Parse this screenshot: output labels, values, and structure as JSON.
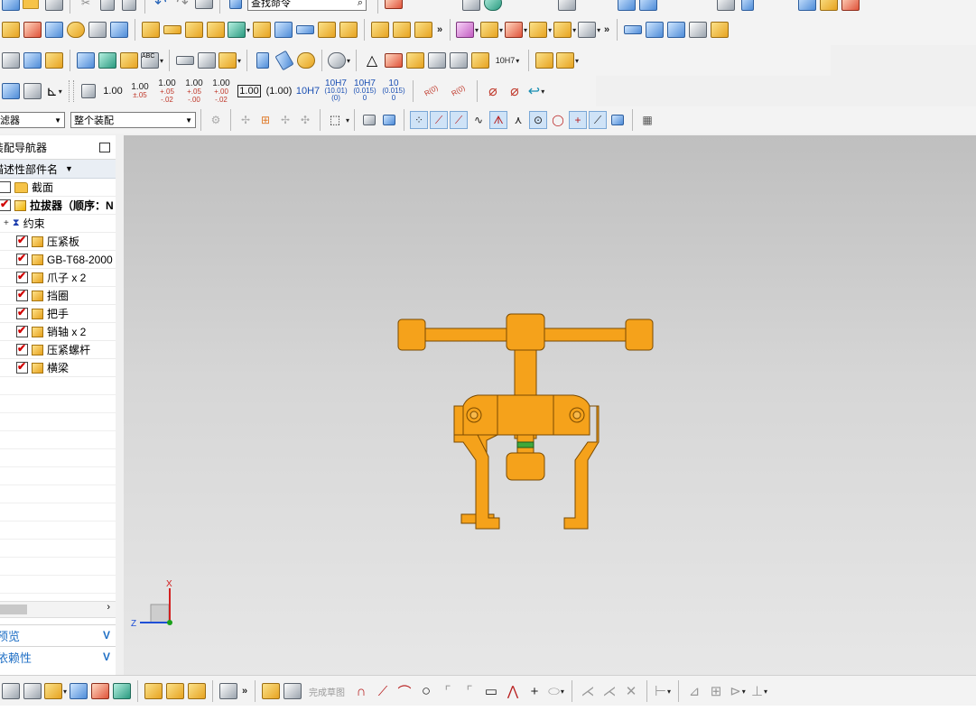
{
  "toolbar": {
    "command_search_placeholder": "查找命令",
    "more": "»",
    "dimension_buttons": [
      {
        "top": "1.00",
        "bottom": ""
      },
      {
        "top": "1.00",
        "bottom": "±.05"
      },
      {
        "top": "1.00",
        "bottom": "+.05\n-.02"
      },
      {
        "top": "1.00",
        "bottom": "+.05\n-.00"
      },
      {
        "top": "1.00",
        "bottom": "+.00\n-.02"
      }
    ],
    "boxed_dim": "1.00",
    "paren_dim": "(1.00)",
    "fit_h7": "10H7",
    "fit_h7_paren": "10H7",
    "fit_h7_paren_sub": "(10.01)\n(0)",
    "fit_h7_tol": "10H7",
    "fit_h7_tol_sub": "(0.015)\n0",
    "fit_10_tol": "10",
    "fit_10_tol_sub": "(0.015)\n0",
    "fit_combo": "10H7",
    "radius_a": "R(0)",
    "radius_b": "R(0)"
  },
  "selection_bar": {
    "filter_label": "滤器",
    "scope_label": "整个装配"
  },
  "navigator": {
    "title": "装配导航器",
    "column_header": "描述性部件名",
    "rows": [
      {
        "label": "截面",
        "checked": false,
        "icon": "folder",
        "indent": 0,
        "bold": false
      },
      {
        "label": "拉拔器（顺序：N",
        "checked": true,
        "icon": "assembly",
        "indent": 0,
        "bold": true
      },
      {
        "label": "约束",
        "checked": null,
        "icon": "constraints",
        "indent": 1,
        "bold": false
      },
      {
        "label": "压紧板",
        "checked": true,
        "icon": "part",
        "indent": 2,
        "bold": false
      },
      {
        "label": "GB-T68-2000",
        "checked": true,
        "icon": "part",
        "indent": 2,
        "bold": false
      },
      {
        "label": "爪子 x 2",
        "checked": true,
        "icon": "part",
        "indent": 2,
        "bold": false
      },
      {
        "label": "挡圈",
        "checked": true,
        "icon": "part",
        "indent": 2,
        "bold": false
      },
      {
        "label": "把手",
        "checked": true,
        "icon": "part",
        "indent": 2,
        "bold": false
      },
      {
        "label": "销轴 x 2",
        "checked": true,
        "icon": "part",
        "indent": 2,
        "bold": false
      },
      {
        "label": "压紧螺杆",
        "checked": true,
        "icon": "part",
        "indent": 2,
        "bold": false
      },
      {
        "label": "横梁",
        "checked": true,
        "icon": "part",
        "indent": 2,
        "bold": false
      }
    ],
    "panels": [
      {
        "label": "预览",
        "chevron": "V"
      },
      {
        "label": "依赖性",
        "chevron": "V"
      }
    ]
  },
  "viewport": {
    "model_color": "#f5a21b",
    "model_edge_color": "#7a4a00",
    "triad": {
      "x_label": "X",
      "z_label": "Z",
      "x_color": "#d22020",
      "z_color": "#1f4fd6",
      "y_color": "#1aa01a"
    }
  },
  "bottombar": {
    "finish_sketch_label": "完成草图"
  }
}
